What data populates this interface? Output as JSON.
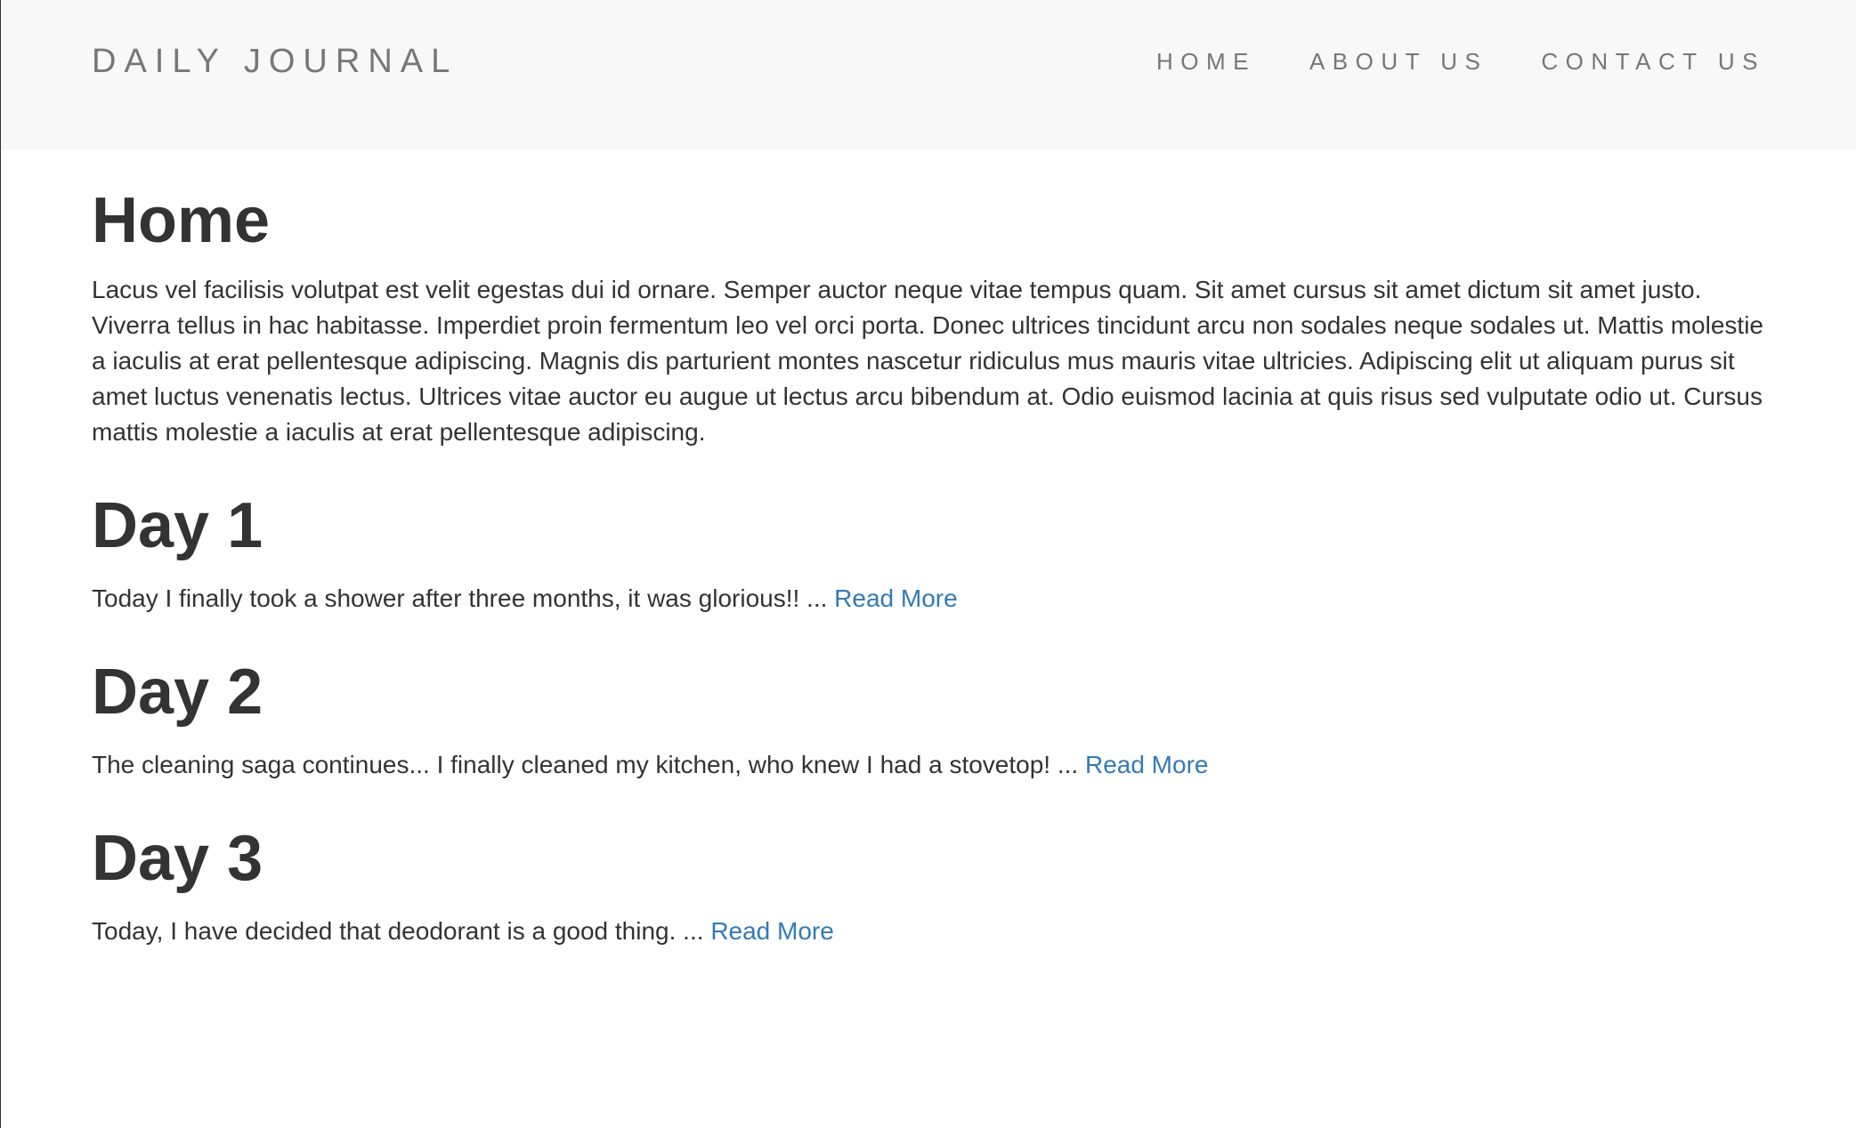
{
  "nav": {
    "brand": "DAILY JOURNAL",
    "links": [
      "HOME",
      "ABOUT US",
      "CONTACT US"
    ]
  },
  "home": {
    "title": "Home",
    "content": "Lacus vel facilisis volutpat est velit egestas dui id ornare. Semper auctor neque vitae tempus quam. Sit amet cursus sit amet dictum sit amet justo. Viverra tellus in hac habitasse. Imperdiet proin fermentum leo vel orci porta. Donec ultrices tincidunt arcu non sodales neque sodales ut. Mattis molestie a iaculis at erat pellentesque adipiscing. Magnis dis parturient montes nascetur ridiculus mus mauris vitae ultricies. Adipiscing elit ut aliquam purus sit amet luctus venenatis lectus. Ultrices vitae auctor eu augue ut lectus arcu bibendum at. Odio euismod lacinia at quis risus sed vulputate odio ut. Cursus mattis molestie a iaculis at erat pellentesque adipiscing."
  },
  "posts": [
    {
      "title": "Day 1",
      "excerpt": "Today I finally took a shower after three months, it was glorious!! ...",
      "link": "Read More"
    },
    {
      "title": "Day 2",
      "excerpt": "The cleaning saga continues... I finally cleaned my kitchen, who knew I had a stovetop! ...",
      "link": "Read More"
    },
    {
      "title": "Day 3",
      "excerpt": "Today, I have decided that deodorant is a good thing. ...",
      "link": "Read More"
    }
  ],
  "colors": {
    "navbar_bg": "#f8f8f8",
    "nav_text": "#777777",
    "body_text": "#333333",
    "link": "#337ab7"
  }
}
